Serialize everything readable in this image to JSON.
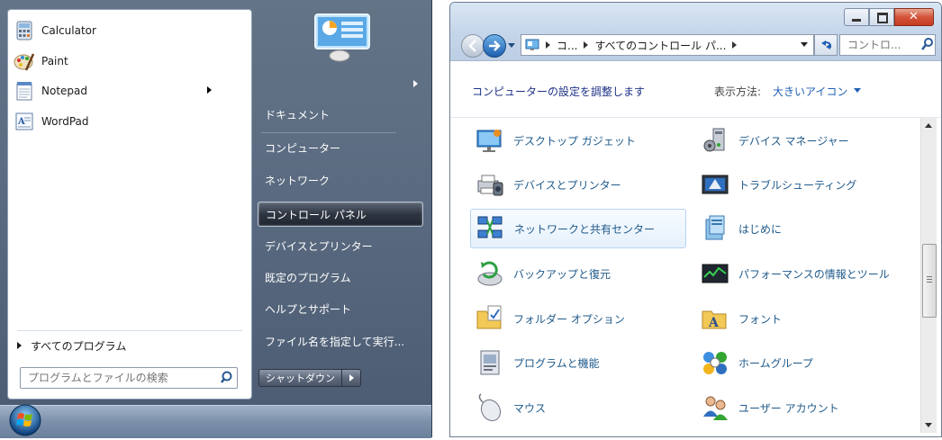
{
  "start_menu": {
    "programs": [
      {
        "label": "Calculator",
        "icon": "calculator-icon",
        "has_submenu": false
      },
      {
        "label": "Paint",
        "icon": "paint-icon",
        "has_submenu": false
      },
      {
        "label": "Notepad",
        "icon": "notepad-icon",
        "has_submenu": true
      },
      {
        "label": "WordPad",
        "icon": "wordpad-icon",
        "has_submenu": false
      }
    ],
    "all_programs": "すべてのプログラム",
    "search_placeholder": "プログラムとファイルの検索",
    "right_items": [
      {
        "label": "ドキュメント"
      },
      {
        "label": "コンピューター"
      },
      {
        "label": "ネットワーク"
      },
      {
        "label": "コントロール パネル",
        "highlighted": true
      },
      {
        "label": "デバイスとプリンター"
      },
      {
        "label": "既定のプログラム"
      },
      {
        "label": "ヘルプとサポート"
      },
      {
        "label": "ファイル名を指定して実行..."
      }
    ],
    "shutdown_label": "シャットダウン"
  },
  "control_panel": {
    "address": {
      "crumb1": "コ...",
      "crumb2": "すべてのコントロール パ..."
    },
    "search_placeholder": "コントロ...",
    "header_title": "コンピューターの設定を調整します",
    "view_by_label": "表示方法:",
    "view_by_value": "大きいアイコン",
    "items": [
      {
        "label": "デスクトップ ガジェット",
        "icon": "desktop-gadgets-icon"
      },
      {
        "label": "デバイス マネージャー",
        "icon": "device-manager-icon"
      },
      {
        "label": "デバイスとプリンター",
        "icon": "devices-printers-icon"
      },
      {
        "label": "トラブルシューティング",
        "icon": "troubleshooting-icon"
      },
      {
        "label": "ネットワークと共有センター",
        "icon": "network-sharing-icon",
        "highlighted": true
      },
      {
        "label": "はじめに",
        "icon": "getting-started-icon"
      },
      {
        "label": "バックアップと復元",
        "icon": "backup-restore-icon"
      },
      {
        "label": "パフォーマンスの情報とツール",
        "icon": "performance-icon"
      },
      {
        "label": "フォルダー オプション",
        "icon": "folder-options-icon"
      },
      {
        "label": "フォント",
        "icon": "fonts-icon"
      },
      {
        "label": "プログラムと機能",
        "icon": "programs-features-icon"
      },
      {
        "label": "ホームグループ",
        "icon": "homegroup-icon"
      },
      {
        "label": "マウス",
        "icon": "mouse-icon"
      },
      {
        "label": "ユーザー アカウント",
        "icon": "user-accounts-icon"
      }
    ]
  },
  "colors": {
    "link_blue": "#1e5fb4",
    "item_text": "#1f5a8a",
    "title_blue": "#1e3287"
  }
}
